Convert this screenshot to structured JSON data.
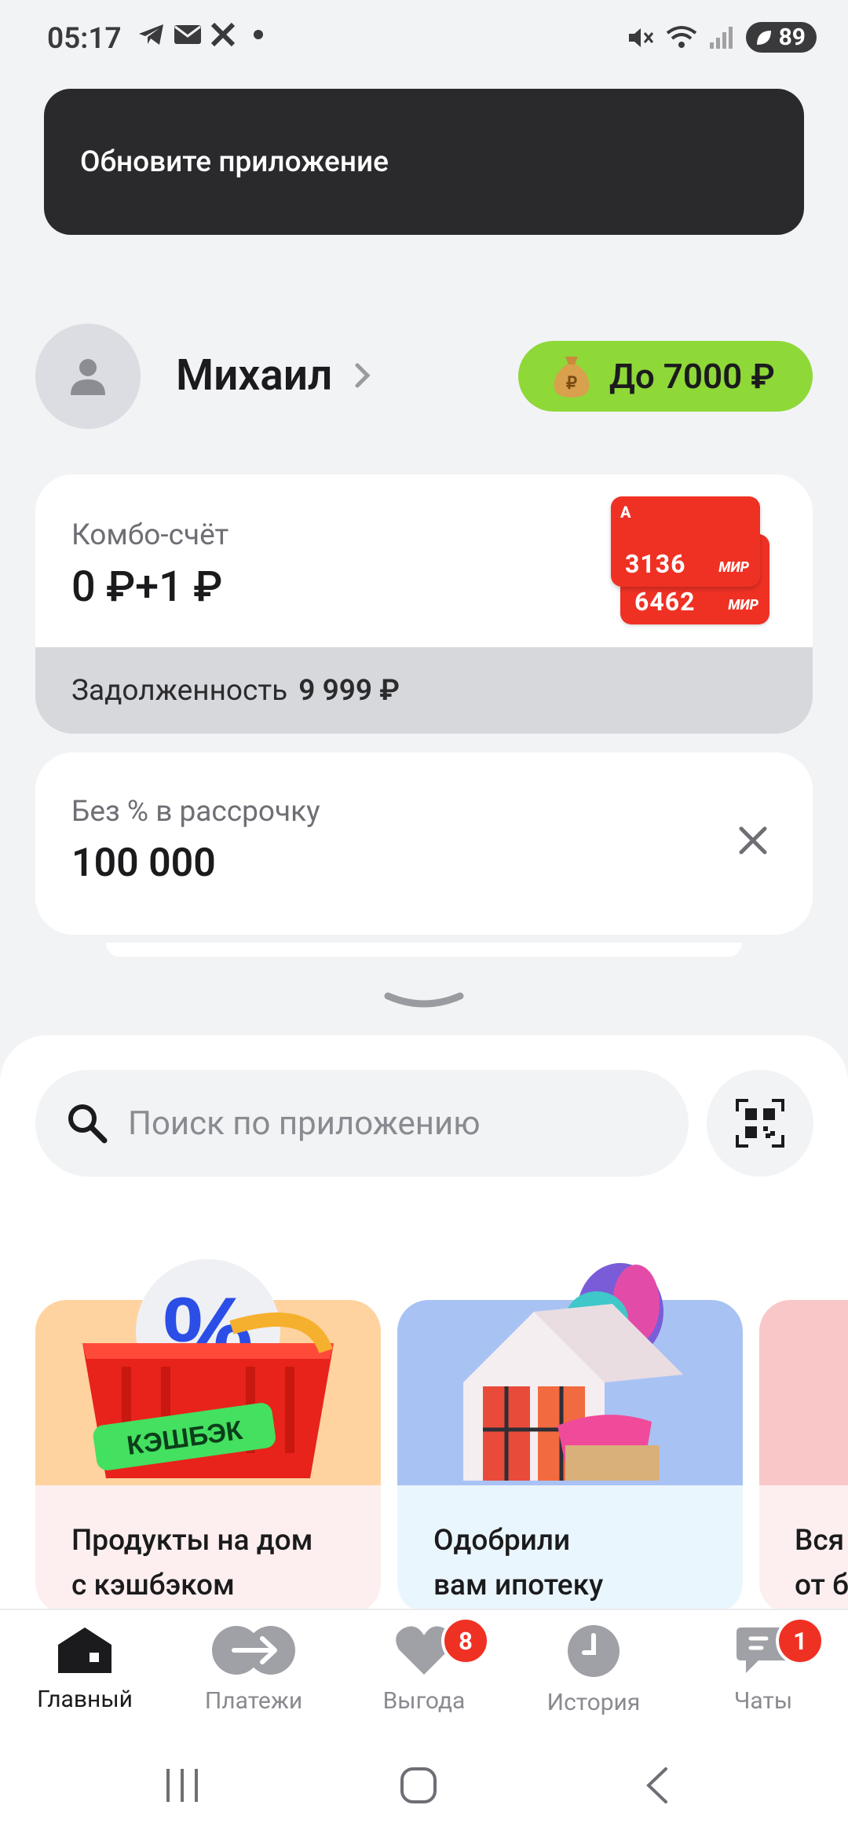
{
  "status_bar": {
    "time": "05:17",
    "battery": "89",
    "left_icons": [
      "telegram-icon",
      "mail-icon",
      "x-icon",
      "dot-icon"
    ],
    "right_icons": [
      "mute-icon",
      "wifi-icon",
      "signal-icon",
      "battery-icon"
    ]
  },
  "banner": {
    "text": "Обновите приложение"
  },
  "profile": {
    "name": "Михаил"
  },
  "bonus": {
    "label": "До 7000 ₽",
    "icon": "money-bag-icon"
  },
  "combo": {
    "title": "Комбо-счёт",
    "balance": "0 ₽+1 ₽",
    "debt_label": "Задолженность",
    "debt_amount": "9 999 ₽",
    "cards": [
      {
        "number": "3136",
        "system": "МИР"
      },
      {
        "number": "6462",
        "system": "МИР"
      }
    ]
  },
  "installment": {
    "title": "Без % в рассрочку",
    "amount": "100 000"
  },
  "search": {
    "placeholder": "Поиск по приложению"
  },
  "promos": [
    {
      "line1": "Продукты на дом",
      "line2": "с кэшбэком",
      "sticker": "КЭШБЭК",
      "bg": "#FDEFEF"
    },
    {
      "line1": "Одобрили",
      "line2": "вам ипотеку",
      "bg": "#EAF6FD"
    },
    {
      "line1": "Вся",
      "line2": "от б",
      "bg": "#FDEFEF"
    }
  ],
  "nav": [
    {
      "label": "Главный",
      "icon": "home-icon",
      "active": true
    },
    {
      "label": "Платежи",
      "icon": "transfer-icon"
    },
    {
      "label": "Выгода",
      "icon": "heart-icon",
      "badge": "8"
    },
    {
      "label": "История",
      "icon": "clock-icon"
    },
    {
      "label": "Чаты",
      "icon": "chat-icon",
      "badge": "1"
    }
  ],
  "colors": {
    "brand_red": "#EF3124",
    "bonus_green": "#8ED838",
    "banner_dark": "#2A2A2C"
  }
}
